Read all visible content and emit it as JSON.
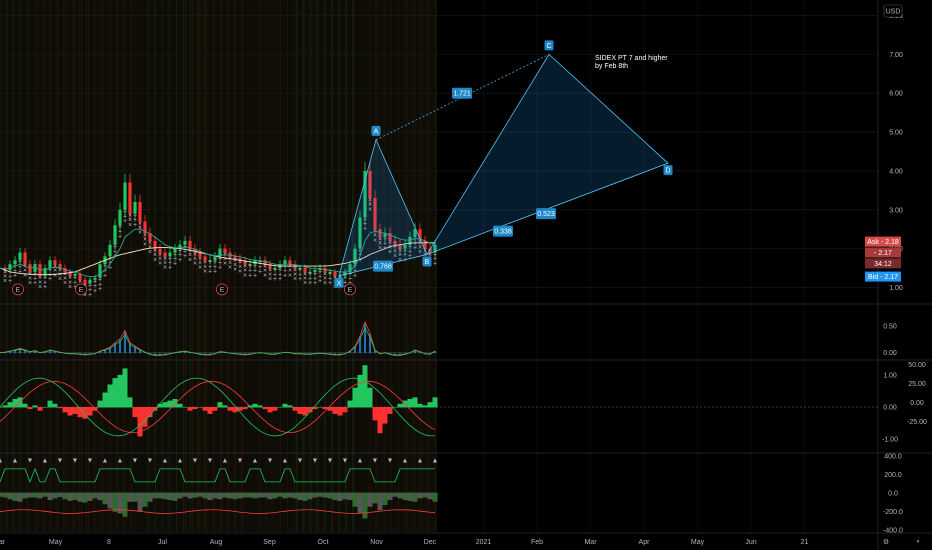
{
  "currency": "USD",
  "colors": {
    "up": "#26a69a",
    "down": "#ef5350",
    "upBright": "#22c55e",
    "downBright": "#ff3030",
    "pattern": "#2196f3",
    "patternFill": "rgba(33,150,243,0.18)",
    "patternLine": "#4fc3f7",
    "ask": "#d84a4a",
    "bid": "#2196f3",
    "grid": "#1c1c1c",
    "text": "#b2b5be"
  },
  "chart_data": {
    "type": "line",
    "title": "",
    "x_ticks": [
      "ar",
      "May",
      "8",
      "Jul",
      "Aug",
      "Sep",
      "Oct",
      "Nov",
      "Dec",
      "2021",
      "Feb",
      "Mar",
      "Apr",
      "May",
      "Jun",
      "21"
    ],
    "price_axis": {
      "ylim": [
        0.6,
        8.4
      ],
      "ticks": [
        "1.00",
        "2.00",
        "3.00",
        "4.00",
        "5.00",
        "6.00",
        "7.00",
        "8.00"
      ]
    },
    "price_series": {
      "name": "",
      "x": [
        0,
        5,
        10,
        15,
        20,
        25,
        30,
        35,
        40,
        45,
        50,
        55,
        60,
        65,
        70,
        75,
        80,
        85,
        90,
        95,
        100,
        105,
        110,
        115,
        120,
        125,
        130,
        135,
        140,
        145,
        150,
        155,
        160,
        165,
        170,
        175,
        180,
        185,
        190,
        195,
        200,
        205,
        210,
        215,
        220,
        225,
        230,
        235,
        240,
        245,
        250,
        255,
        260,
        265,
        270,
        275,
        280,
        285,
        290,
        295,
        300,
        305,
        310,
        315,
        320,
        325,
        330,
        335,
        340,
        345,
        350,
        355,
        360,
        365,
        370,
        375,
        380,
        385,
        390,
        395,
        400,
        405,
        410,
        415,
        420,
        425,
        430,
        435
      ],
      "y": [
        1.5,
        1.45,
        1.6,
        1.7,
        1.9,
        1.6,
        1.4,
        1.6,
        1.3,
        1.5,
        1.7,
        1.6,
        1.5,
        1.4,
        1.3,
        1.35,
        1.2,
        1.1,
        1.2,
        1.25,
        1.6,
        1.8,
        2.1,
        2.6,
        3.0,
        3.7,
        2.9,
        3.2,
        2.7,
        2.4,
        2.2,
        2.0,
        1.9,
        1.8,
        1.9,
        2.0,
        2.1,
        2.2,
        2.0,
        1.9,
        1.8,
        1.7,
        1.7,
        1.8,
        2.0,
        1.9,
        1.8,
        1.75,
        1.7,
        1.6,
        1.6,
        1.7,
        1.7,
        1.6,
        1.5,
        1.5,
        1.6,
        1.7,
        1.6,
        1.5,
        1.5,
        1.4,
        1.4,
        1.45,
        1.5,
        1.4,
        1.4,
        1.3,
        1.3,
        1.4,
        1.6,
        2.0,
        2.8,
        4.0,
        3.3,
        2.5,
        2.3,
        2.4,
        2.2,
        2.1,
        2.0,
        2.1,
        2.3,
        2.5,
        2.2,
        2.0,
        1.9,
        2.1
      ]
    },
    "ma_series": [
      {
        "name": "",
        "color": "#f7e6c4",
        "y": [
          1.5,
          1.45,
          1.4,
          1.38,
          1.36,
          1.35,
          1.34,
          1.33,
          1.33,
          1.33,
          1.33,
          1.34,
          1.35,
          1.36,
          1.38,
          1.4,
          1.45,
          1.5,
          1.55,
          1.6,
          1.65,
          1.7,
          1.75,
          1.8,
          1.84,
          1.87,
          1.9,
          1.93,
          1.96,
          1.99,
          2.01,
          2.02,
          2.03,
          2.03,
          2.02,
          2.01,
          2.0,
          1.98,
          1.96,
          1.93,
          1.9,
          1.87,
          1.84,
          1.81,
          1.78,
          1.76,
          1.74,
          1.72,
          1.7,
          1.68,
          1.66,
          1.64,
          1.62,
          1.6,
          1.58,
          1.56,
          1.55,
          1.55,
          1.55,
          1.55,
          1.55,
          1.55,
          1.55,
          1.55,
          1.55,
          1.55,
          1.56,
          1.58,
          1.6,
          1.62,
          1.65,
          1.68,
          1.72,
          1.78,
          1.85,
          1.9,
          1.95,
          2.0,
          2.05,
          2.08,
          2.1,
          2.12,
          2.14,
          2.15,
          2.15,
          2.15,
          2.15,
          2.15
        ]
      },
      {
        "name": "",
        "color": "#26a69a",
        "y": [
          1.5,
          1.48,
          1.5,
          1.55,
          1.6,
          1.55,
          1.5,
          1.52,
          1.45,
          1.45,
          1.5,
          1.52,
          1.5,
          1.46,
          1.42,
          1.4,
          1.35,
          1.3,
          1.28,
          1.28,
          1.35,
          1.45,
          1.6,
          1.8,
          2.0,
          2.3,
          2.4,
          2.5,
          2.5,
          2.45,
          2.38,
          2.3,
          2.2,
          2.1,
          2.05,
          2.02,
          2.02,
          2.04,
          2.02,
          1.98,
          1.93,
          1.88,
          1.83,
          1.81,
          1.83,
          1.84,
          1.83,
          1.81,
          1.79,
          1.76,
          1.72,
          1.7,
          1.69,
          1.67,
          1.63,
          1.6,
          1.59,
          1.6,
          1.6,
          1.58,
          1.56,
          1.53,
          1.5,
          1.48,
          1.48,
          1.46,
          1.44,
          1.42,
          1.4,
          1.4,
          1.44,
          1.55,
          1.8,
          2.2,
          2.4,
          2.45,
          2.42,
          2.4,
          2.35,
          2.3,
          2.25,
          2.22,
          2.22,
          2.26,
          2.25,
          2.2,
          2.14,
          2.12
        ]
      }
    ],
    "harmonic_pattern": {
      "points": [
        {
          "label": "X",
          "x": 339,
          "y": 1.3
        },
        {
          "label": "A",
          "x": 376,
          "y": 4.8
        },
        {
          "label": "B",
          "x": 427,
          "y": 1.85
        },
        {
          "label": "C",
          "x": 549,
          "y": 7.0
        },
        {
          "label": "D",
          "x": 668,
          "y": 4.2
        }
      ],
      "ratios": [
        {
          "value": "0.768",
          "x": 383,
          "y": 1.55
        },
        {
          "value": "1.721",
          "x": 462,
          "y": 6.0
        },
        {
          "value": "0.338",
          "x": 503,
          "y": 2.45
        },
        {
          "value": "0.523",
          "x": 546,
          "y": 2.9
        }
      ],
      "note": [
        "SIDEX PT 7 and higher",
        "by Feb 8th"
      ]
    },
    "last_price_labels": [
      {
        "text": "Ask - 2.18",
        "color": "#d84a4a",
        "y": 2.18
      },
      {
        "text": "- 2.17",
        "color": "#a93a3a",
        "y": 1.9
      },
      {
        "text": "34:12",
        "color": "#7a2a2a",
        "y": 1.62
      },
      {
        "text": "Bid - 2.17",
        "color": "#2196f3",
        "y": 1.28
      }
    ],
    "earnings_markers": [
      {
        "label": "E",
        "x": 18,
        "y": 0.95
      },
      {
        "label": "E",
        "x": 81,
        "y": 0.95
      },
      {
        "label": "E",
        "x": 222,
        "y": 0.95
      },
      {
        "label": "E",
        "x": 350,
        "y": 0.95
      }
    ],
    "panels": [
      {
        "name": "",
        "ylim": [
          -0.1,
          0.9
        ],
        "ticks": [
          "0.50",
          "0.00"
        ]
      },
      {
        "name": "",
        "ylim": [
          -1.4,
          1.4
        ],
        "ticks": [
          "1.00",
          "0.00",
          "-1.00"
        ],
        "right_ticks": [
          "50.00",
          "25.00",
          "0.00",
          "-25.00"
        ]
      },
      {
        "name": "",
        "ylim": [
          -420,
          420
        ],
        "ticks": [
          "400.0",
          "200.0",
          "0.0",
          "-200.0",
          "-400.0"
        ]
      }
    ],
    "osc1": [
      0.0,
      0.01,
      0.03,
      0.05,
      0.08,
      0.05,
      0.02,
      0.04,
      0.0,
      0.02,
      0.05,
      0.03,
      0.01,
      -0.01,
      -0.02,
      -0.02,
      -0.03,
      -0.04,
      -0.03,
      -0.02,
      0.03,
      0.06,
      0.1,
      0.18,
      0.25,
      0.4,
      0.18,
      0.12,
      0.06,
      0.01,
      -0.03,
      -0.05,
      -0.05,
      -0.04,
      -0.02,
      0.0,
      0.02,
      0.03,
      0.01,
      -0.01,
      -0.03,
      -0.04,
      -0.04,
      -0.02,
      0.02,
      0.01,
      -0.01,
      -0.02,
      -0.03,
      -0.04,
      -0.03,
      -0.01,
      0.0,
      -0.01,
      -0.03,
      -0.03,
      -0.01,
      0.01,
      0.0,
      -0.02,
      -0.02,
      -0.03,
      -0.03,
      -0.02,
      -0.01,
      -0.02,
      -0.03,
      -0.04,
      -0.04,
      -0.02,
      0.03,
      0.12,
      0.3,
      0.55,
      0.35,
      0.05,
      -0.02,
      0.0,
      -0.03,
      -0.05,
      -0.05,
      -0.03,
      0.0,
      0.05,
      0.02,
      -0.02,
      -0.03,
      0.03
    ],
    "osc2": [
      0.0,
      0.05,
      0.15,
      0.25,
      0.3,
      0.1,
      -0.05,
      0.05,
      -0.1,
      0.0,
      0.2,
      0.1,
      -0.02,
      -0.15,
      -0.25,
      -0.2,
      -0.3,
      -0.35,
      -0.25,
      -0.1,
      0.2,
      0.45,
      0.7,
      0.9,
      1.0,
      1.2,
      0.3,
      -0.3,
      -0.9,
      -0.6,
      -0.3,
      -0.1,
      0.1,
      0.15,
      0.2,
      0.25,
      0.1,
      0.0,
      -0.1,
      -0.05,
      0.0,
      -0.1,
      -0.2,
      -0.1,
      0.15,
      0.05,
      -0.1,
      -0.15,
      -0.1,
      -0.05,
      0.05,
      0.1,
      0.05,
      -0.05,
      -0.15,
      -0.1,
      0.0,
      0.1,
      0.05,
      -0.1,
      -0.2,
      -0.25,
      -0.15,
      -0.05,
      0.0,
      -0.05,
      -0.1,
      -0.2,
      -0.25,
      -0.15,
      0.2,
      0.6,
      1.0,
      1.3,
      0.6,
      -0.4,
      -0.8,
      -0.5,
      -0.2,
      0.0,
      0.1,
      0.2,
      0.25,
      0.3,
      0.1,
      0.05,
      0.15,
      0.3
    ]
  },
  "icons": {
    "settings": "gear-icon",
    "auto": "auto-scale-icon"
  },
  "axis_buttons": {
    "left": "⚙",
    "right": "⚬"
  }
}
